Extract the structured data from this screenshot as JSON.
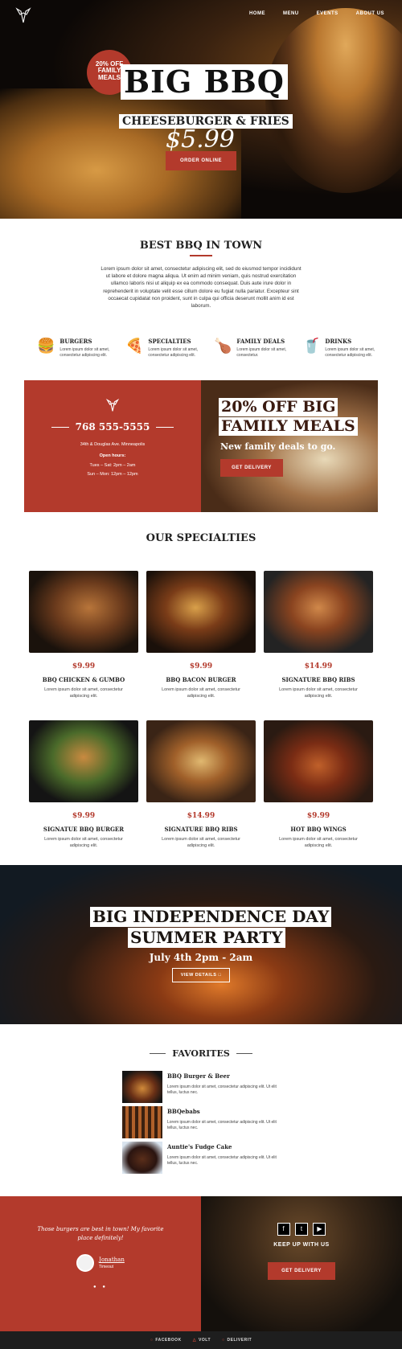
{
  "nav": {
    "items": [
      "HOME",
      "MENU",
      "EVENTS",
      "ABOUT US"
    ]
  },
  "hero": {
    "badge": "20% OFF FAMILY MEALS",
    "title": "BIG BBQ",
    "subtitle": "CHEESEBURGER & FRIES",
    "price": "$5.99",
    "order_button": "ORDER ONLINE"
  },
  "intro": {
    "heading": "BEST BBQ IN TOWN",
    "text": "Lorem ipsum dolor sit amet, consectetur adipiscing elit, sed do eiusmod tempor incididunt ut labore et dolore magna aliqua. Ut enim ad minim veniam, quis nostrud exercitation ullamco laboris nisi ut aliquip ex ea commodo consequat. Duis aute irure dolor in reprehenderit in voluptate velit esse cillum dolore eu fugiat nulla pariatur. Excepteur sint occaecat cupidatat non proident, sunt in culpa qui officia deserunt mollit anim id est laborum."
  },
  "categories": [
    {
      "icon": "burger-icon",
      "title": "BURGERS",
      "text": "Lorem ipsum dolor sit amet, consectetur adipiscing elit."
    },
    {
      "icon": "pizza-slice-icon",
      "title": "SPECIALTIES",
      "text": "Lorem ipsum dolor sit amet, consectetur adipiscing elit."
    },
    {
      "icon": "family-meal-icon",
      "title": "FAMILY DEALS",
      "text": "Lorem ipsum dolor sit amet, consectetur."
    },
    {
      "icon": "drink-cup-icon",
      "title": "DRINKS",
      "text": "Lorem ipsum dolor sit amet, consectetur adipiscing elit."
    }
  ],
  "contact": {
    "phone": "768 555-5555",
    "address": "34th & Douglas Ave. Minneapolis",
    "hours_label": "Open hours:",
    "hours_1": "Tues – Sat: 2pm – 2am",
    "hours_2": "Sun – Mon: 12pm – 12pm"
  },
  "promo": {
    "line1": "20% OFF BIG",
    "line2": "FAMILY MEALS",
    "sub": "New family deals to go.",
    "button": "GET DELIVERY"
  },
  "specialties": {
    "heading": "OUR SPECIALTIES",
    "items": [
      {
        "price": "$9.99",
        "name": "BBQ CHICKEN & GUMBO",
        "desc": "Lorem ipsum dolor sit amet, consectetur adipiscing elit."
      },
      {
        "price": "$9.99",
        "name": "BBQ BACON BURGER",
        "desc": "Lorem ipsum dolor sit amet, consectetur adipiscing elit."
      },
      {
        "price": "$14.99",
        "name": "SIGNATURE BBQ RIBS",
        "desc": "Lorem ipsum dolor sit amet, consectetur adipiscing elit."
      },
      {
        "price": "$9.99",
        "name": "SIGNATUE BBQ BURGER",
        "desc": "Lorem ipsum dolor sit amet, consectetur adipiscing elit."
      },
      {
        "price": "$14.99",
        "name": "SIGNATURE BBQ RIBS",
        "desc": "Lorem ipsum dolor sit amet, consectetur adipiscing elit."
      },
      {
        "price": "$9.99",
        "name": "HOT BBQ WINGS",
        "desc": "Lorem ipsum dolor sit amet, consectetur adipiscing elit."
      }
    ]
  },
  "party": {
    "line1": "BIG INDEPENDENCE DAY",
    "line2": "SUMMER PARTY",
    "sub": "July 4th 2pm - 2am",
    "button": "VIEW DETAILS"
  },
  "favorites": {
    "heading": "FAVORITES",
    "items": [
      {
        "name": "BBQ Burger & Beer",
        "desc": "Lorem ipsum dolor sit amet, consectetur adipiscing elit. Ut elit tellus, luctus nec."
      },
      {
        "name": "BBQebabs",
        "desc": "Lorem ipsum dolor sit amet, consectetur adipiscing elit. Ut elit tellus, luctus nec."
      },
      {
        "name": "Auntie's Fudge Cake",
        "desc": "Lorem ipsum dolor sit amet, consectetur adipiscing elit. Ut elit tellus, luctus nec."
      }
    ]
  },
  "testimonial": {
    "quote": "Those burgers are best in town! My favorite place definitely!",
    "name": "Jonathan",
    "source": "Timeout"
  },
  "social": {
    "heading": "KEEP UP WITH US",
    "button": "GET DELIVERY"
  },
  "footer": {
    "links": [
      "FACEBOOK",
      "VOLT",
      "DELIVERIT"
    ]
  },
  "colors": {
    "accent": "#b33a2c",
    "dark": "#1e1e1e"
  }
}
